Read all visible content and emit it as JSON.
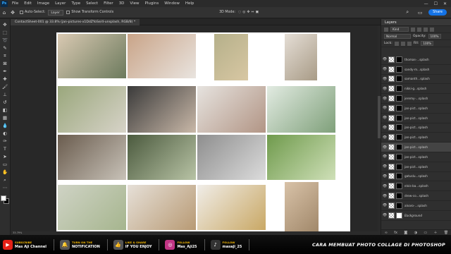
{
  "menu": {
    "app_logo": "Ps",
    "items": [
      "File",
      "Edit",
      "Image",
      "Layer",
      "Type",
      "Select",
      "Filter",
      "3D",
      "View",
      "Plugins",
      "Window",
      "Help"
    ],
    "window_controls": [
      "—",
      "☐",
      "✕"
    ]
  },
  "options_bar": {
    "auto_select_label": "Auto-Select:",
    "auto_select_value": "Layer",
    "transform_label": "Show Transform Controls",
    "mode_3d_label": "3D Mode:",
    "share_label": "Share"
  },
  "tools": [
    "move-icon",
    "marquee-icon",
    "lasso-icon",
    "quick-select-icon",
    "crop-icon",
    "frame-icon",
    "eyedropper-icon",
    "healing-icon",
    "brush-icon",
    "clone-stamp-icon",
    "history-brush-icon",
    "eraser-icon",
    "gradient-icon",
    "blur-icon",
    "dodge-icon",
    "pen-icon",
    "type-icon",
    "path-select-icon",
    "rectangle-icon",
    "hand-icon",
    "zoom-icon",
    "more-tools-icon"
  ],
  "document": {
    "tab_title": "ContactSheet-001 @ 33.8% (jan-pictures-x1DdZYoSe/4-unsplash, RGB/8) *",
    "status": "33.79%"
  },
  "photos": [
    {
      "name": "photo-wedding-table",
      "c1": "#d9c9b2",
      "c2": "#6c7a5d"
    },
    {
      "name": "photo-ring-hands",
      "c1": "#c9a488",
      "c2": "#e9e4df"
    },
    {
      "name": "photo-couple-field",
      "c1": "#b5b08a",
      "c2": "#d8c7a3"
    },
    {
      "name": "photo-couple-walkway",
      "c1": "#e5ded6",
      "c2": "#a89b86"
    },
    {
      "name": "photo-couple-trees",
      "c1": "#9aa77c",
      "c2": "#d7d3c8"
    },
    {
      "name": "photo-holding-hands",
      "c1": "#3a3a3a",
      "c2": "#c9b8a8"
    },
    {
      "name": "photo-bride-portrait",
      "c1": "#e6e3df",
      "c2": "#b29585"
    },
    {
      "name": "photo-floral-arch",
      "c1": "#e2ebe2",
      "c2": "#7fa07a"
    },
    {
      "name": "photo-group-party",
      "c1": "#6a5c4e",
      "c2": "#c8c2b8"
    },
    {
      "name": "photo-forest-couple",
      "c1": "#4b5a3e",
      "c2": "#b8c3a5"
    },
    {
      "name": "photo-window-couple",
      "c1": "#8e8e8e",
      "c2": "#dcdcdc"
    },
    {
      "name": "photo-garden-chairs",
      "c1": "#6f9a4c",
      "c2": "#cfe0b8"
    },
    {
      "name": "photo-bouquet-dress",
      "c1": "#cfd3c5",
      "c2": "#a6b58e"
    },
    {
      "name": "photo-bouquet-drape",
      "c1": "#e6e0d8",
      "c2": "#b89a74"
    },
    {
      "name": "photo-rings-closeup",
      "c1": "#f0ede8",
      "c2": "#c9a865"
    },
    {
      "name": "photo-table-setting",
      "c1": "#d8c2a8",
      "c2": "#a1886a"
    }
  ],
  "layers_panel": {
    "tab_label": "Layers",
    "filter_label": "Kind",
    "blend_mode": "Normal",
    "opacity_label": "Opacity:",
    "opacity_value": "100%",
    "lock_label": "Lock:",
    "fill_label": "Fill:",
    "fill_value": "100%",
    "layers": [
      {
        "name": "thomas-...splash",
        "selected": false,
        "mask": "black"
      },
      {
        "name": "sandy-m...splash",
        "selected": false,
        "mask": "black"
      },
      {
        "name": "samanth...splash",
        "selected": false,
        "mask": "black"
      },
      {
        "name": "nikki-g...splash",
        "selected": false,
        "mask": "black"
      },
      {
        "name": "jeremy-...splash",
        "selected": false,
        "mask": "black"
      },
      {
        "name": "jan-pict...splash",
        "selected": false,
        "mask": "black"
      },
      {
        "name": "jan-pict...splash",
        "selected": false,
        "mask": "black"
      },
      {
        "name": "jan-pict...splash",
        "selected": false,
        "mask": "black"
      },
      {
        "name": "jan-pict...splash",
        "selected": false,
        "mask": "black"
      },
      {
        "name": "jan-pict...splash",
        "selected": true,
        "mask": "black"
      },
      {
        "name": "jan-pict...splash",
        "selected": false,
        "mask": "black"
      },
      {
        "name": "jan-pict...splash",
        "selected": false,
        "mask": "black"
      },
      {
        "name": "gatuslu...splash",
        "selected": false,
        "mask": "black"
      },
      {
        "name": "elvis-ba...splash",
        "selected": false,
        "mask": "black"
      },
      {
        "name": "drew-co...splash",
        "selected": false,
        "mask": "black"
      },
      {
        "name": "alvaro-...splash",
        "selected": false,
        "mask": "black"
      },
      {
        "name": "Background",
        "selected": false,
        "mask": "white"
      }
    ]
  },
  "banner": {
    "items": [
      {
        "icon": "▶",
        "color": "#e62117",
        "top": "SUBSCRIBE",
        "bottom": "Mas Aji Channel"
      },
      {
        "icon": "🔔",
        "color": "#555555",
        "top": "TURN ON THE",
        "bottom": "NOTIFICATION"
      },
      {
        "icon": "👍",
        "color": "#555555",
        "top": "LIKE & SHARE",
        "bottom": "IF YOU ENJOY"
      },
      {
        "icon": "◎",
        "color": "#c13584",
        "top": "FOLLOW",
        "bottom": "Mas_Aji25"
      },
      {
        "icon": "♪",
        "color": "#333333",
        "top": "FOLLOW",
        "bottom": "masaji_25"
      }
    ],
    "title": "CARA MEMBUAT PHOTO COLLAGE DI PHOTOSHOP"
  }
}
